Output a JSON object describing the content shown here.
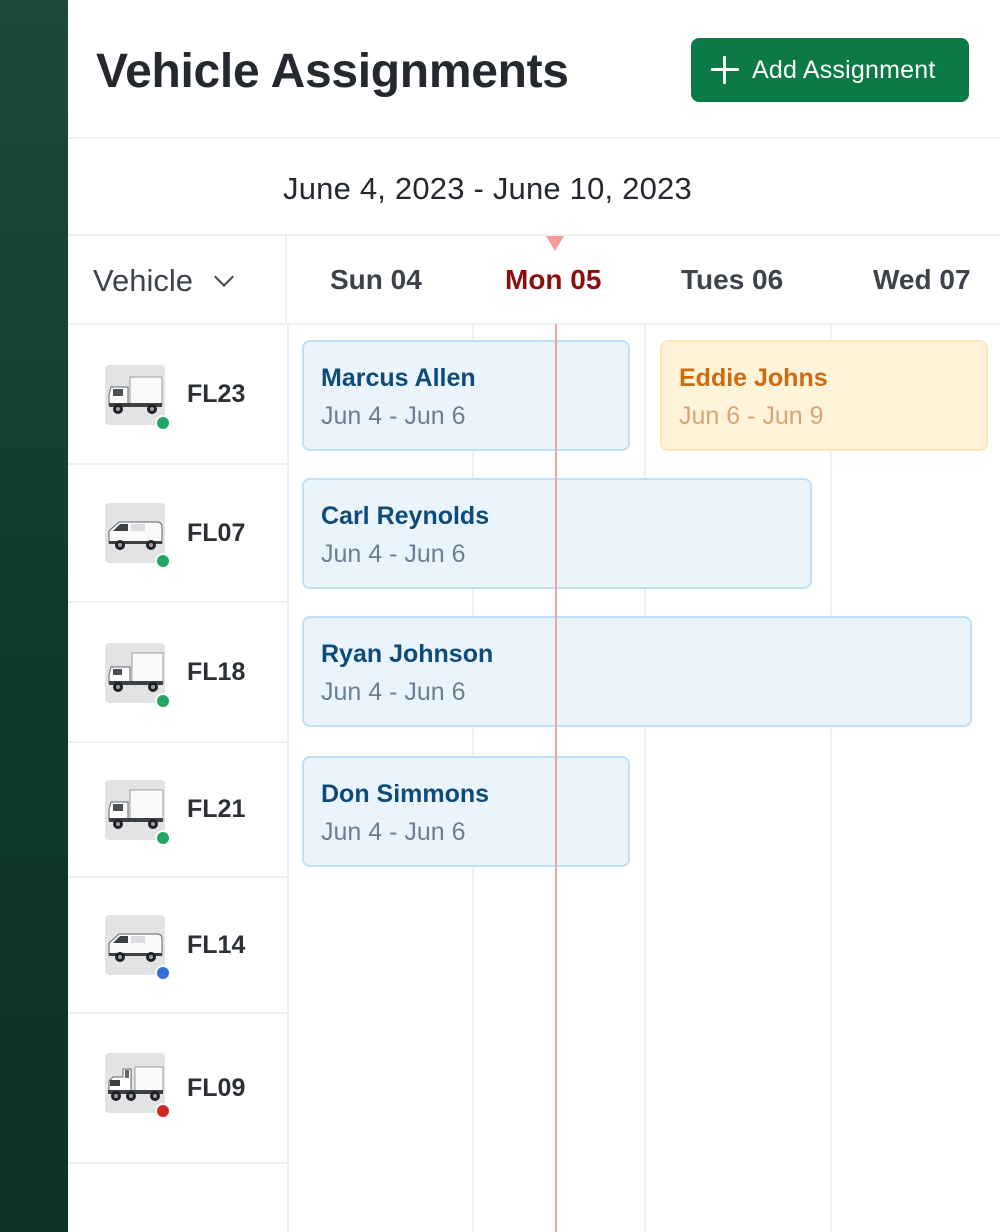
{
  "header": {
    "title": "Vehicle Assignments",
    "add_button_label": "Add Assignment"
  },
  "calendar": {
    "date_range": "June 4, 2023 - June 10, 2023",
    "vehicle_column_label": "Vehicle",
    "days": [
      {
        "label": "Sun 04",
        "is_today": false
      },
      {
        "label": "Mon 05",
        "is_today": true
      },
      {
        "label": "Tues 06",
        "is_today": false
      },
      {
        "label": "Wed 07",
        "is_today": false
      }
    ]
  },
  "vehicles": [
    {
      "id": "FL23",
      "type": "box-truck-icon",
      "status": "active",
      "status_color": "#22a565"
    },
    {
      "id": "FL07",
      "type": "van-icon",
      "status": "active",
      "status_color": "#22a565"
    },
    {
      "id": "FL18",
      "type": "box-truck-icon",
      "status": "active",
      "status_color": "#22a565"
    },
    {
      "id": "FL21",
      "type": "box-truck-icon",
      "status": "active",
      "status_color": "#22a565"
    },
    {
      "id": "FL14",
      "type": "van-icon",
      "status": "available",
      "status_color": "#2f6fd6"
    },
    {
      "id": "FL09",
      "type": "semi-truck-icon",
      "status": "out-of-service",
      "status_color": "#cf2a22"
    }
  ],
  "assignments": [
    {
      "driver": "Marcus Allen",
      "dates": "Jun 4 - Jun 6",
      "vehicle": "FL23",
      "style": "confirmed"
    },
    {
      "driver": "Eddie Johns",
      "dates": "Jun 6 - Jun 9",
      "vehicle": "FL23",
      "style": "pending"
    },
    {
      "driver": "Carl Reynolds",
      "dates": "Jun 4 - Jun 6",
      "vehicle": "FL07",
      "style": "confirmed"
    },
    {
      "driver": "Ryan Johnson",
      "dates": "Jun 4 - Jun 6",
      "vehicle": "FL18",
      "style": "confirmed"
    },
    {
      "driver": "Don Simmons",
      "dates": "Jun 4 - Jun 6",
      "vehicle": "FL21",
      "style": "confirmed"
    }
  ],
  "colors": {
    "sidebar": "#0f3a2b",
    "primary_button": "#0b7a45",
    "today_text": "#8a1010",
    "now_line": "#f2a5a5",
    "card_confirmed_bg": "#e9f4fd",
    "card_pending_bg": "#fff4d9"
  }
}
